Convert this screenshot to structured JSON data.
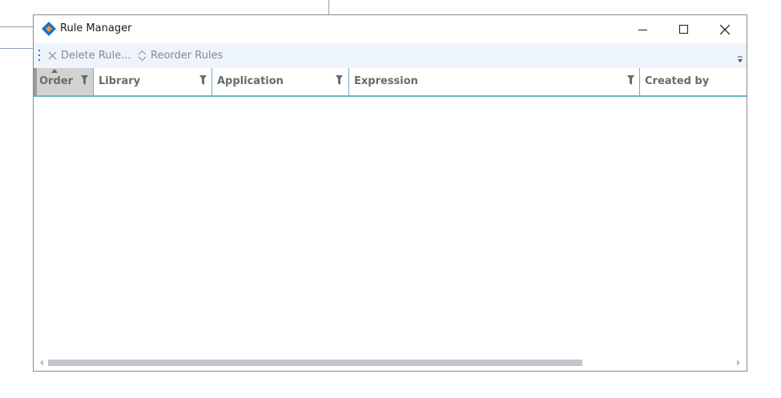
{
  "window": {
    "title": "Rule Manager",
    "brand_colors": [
      "#1e6fd0",
      "#f39a1e"
    ]
  },
  "toolbar": {
    "delete_label": "Delete Rule...",
    "reorder_label": "Reorder Rules"
  },
  "grid": {
    "columns": [
      {
        "label": "Order",
        "sorted": "ascending",
        "filter": true
      },
      {
        "label": "Library",
        "filter": true
      },
      {
        "label": "Application",
        "filter": true
      },
      {
        "label": "Expression",
        "filter": true
      },
      {
        "label": "Created by",
        "filter": false
      }
    ],
    "rows": [],
    "accent_color": "#67b4be"
  },
  "scrollbar": {
    "horizontal_position": 0,
    "visible_fraction": 0.78
  }
}
